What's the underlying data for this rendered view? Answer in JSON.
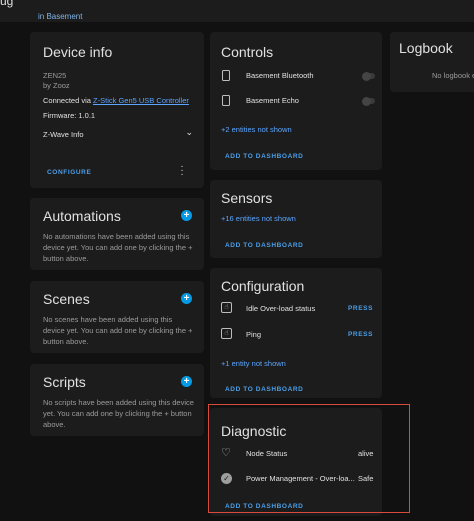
{
  "topbar": {
    "cut_text": "ug",
    "area_link": "in Basement"
  },
  "device_info": {
    "title": "Device info",
    "model": "ZEN25",
    "manufacturer": "by Zooz",
    "connected_prefix": "Connected via ",
    "connected_link": "Z-Stick Gen5 USB Controller",
    "firmware": "Firmware: 1.0.1",
    "zwave_info": "Z-Wave Info",
    "configure": "CONFIGURE"
  },
  "automations": {
    "title": "Automations",
    "empty_text": "No automations have been added using this device yet. You can add one by clicking the + button above."
  },
  "scenes": {
    "title": "Scenes",
    "empty_text": "No scenes have been added using this device yet. You can add one by clicking the + button above."
  },
  "scripts": {
    "title": "Scripts",
    "empty_text": "No scripts have been added using this device yet. You can add one by clicking the + button above."
  },
  "controls": {
    "title": "Controls",
    "entities": [
      {
        "name": "Basement Bluetooth"
      },
      {
        "name": "Basement Echo"
      }
    ],
    "hidden": "+2 entities not shown",
    "add": "ADD TO DASHBOARD"
  },
  "sensors": {
    "title": "Sensors",
    "hidden": "+16 entities not shown",
    "add": "ADD TO DASHBOARD"
  },
  "configuration": {
    "title": "Configuration",
    "entities": [
      {
        "name": "Idle Over-load status",
        "action": "PRESS"
      },
      {
        "name": "Ping",
        "action": "PRESS"
      }
    ],
    "hidden": "+1 entity not shown",
    "add": "ADD TO DASHBOARD"
  },
  "diagnostic": {
    "title": "Diagnostic",
    "entities": [
      {
        "name": "Node Status",
        "state": "alive"
      },
      {
        "name": "Power Management - Over-loa...",
        "state": "Safe"
      }
    ],
    "add": "ADD TO DASHBOARD"
  },
  "logbook": {
    "title": "Logbook",
    "empty": "No logbook e"
  },
  "colors": {
    "accent": "#039be5",
    "link": "#5aa5ff",
    "highlight": "#d94b3b",
    "background": "#111111",
    "card": "#1c1c1c"
  }
}
